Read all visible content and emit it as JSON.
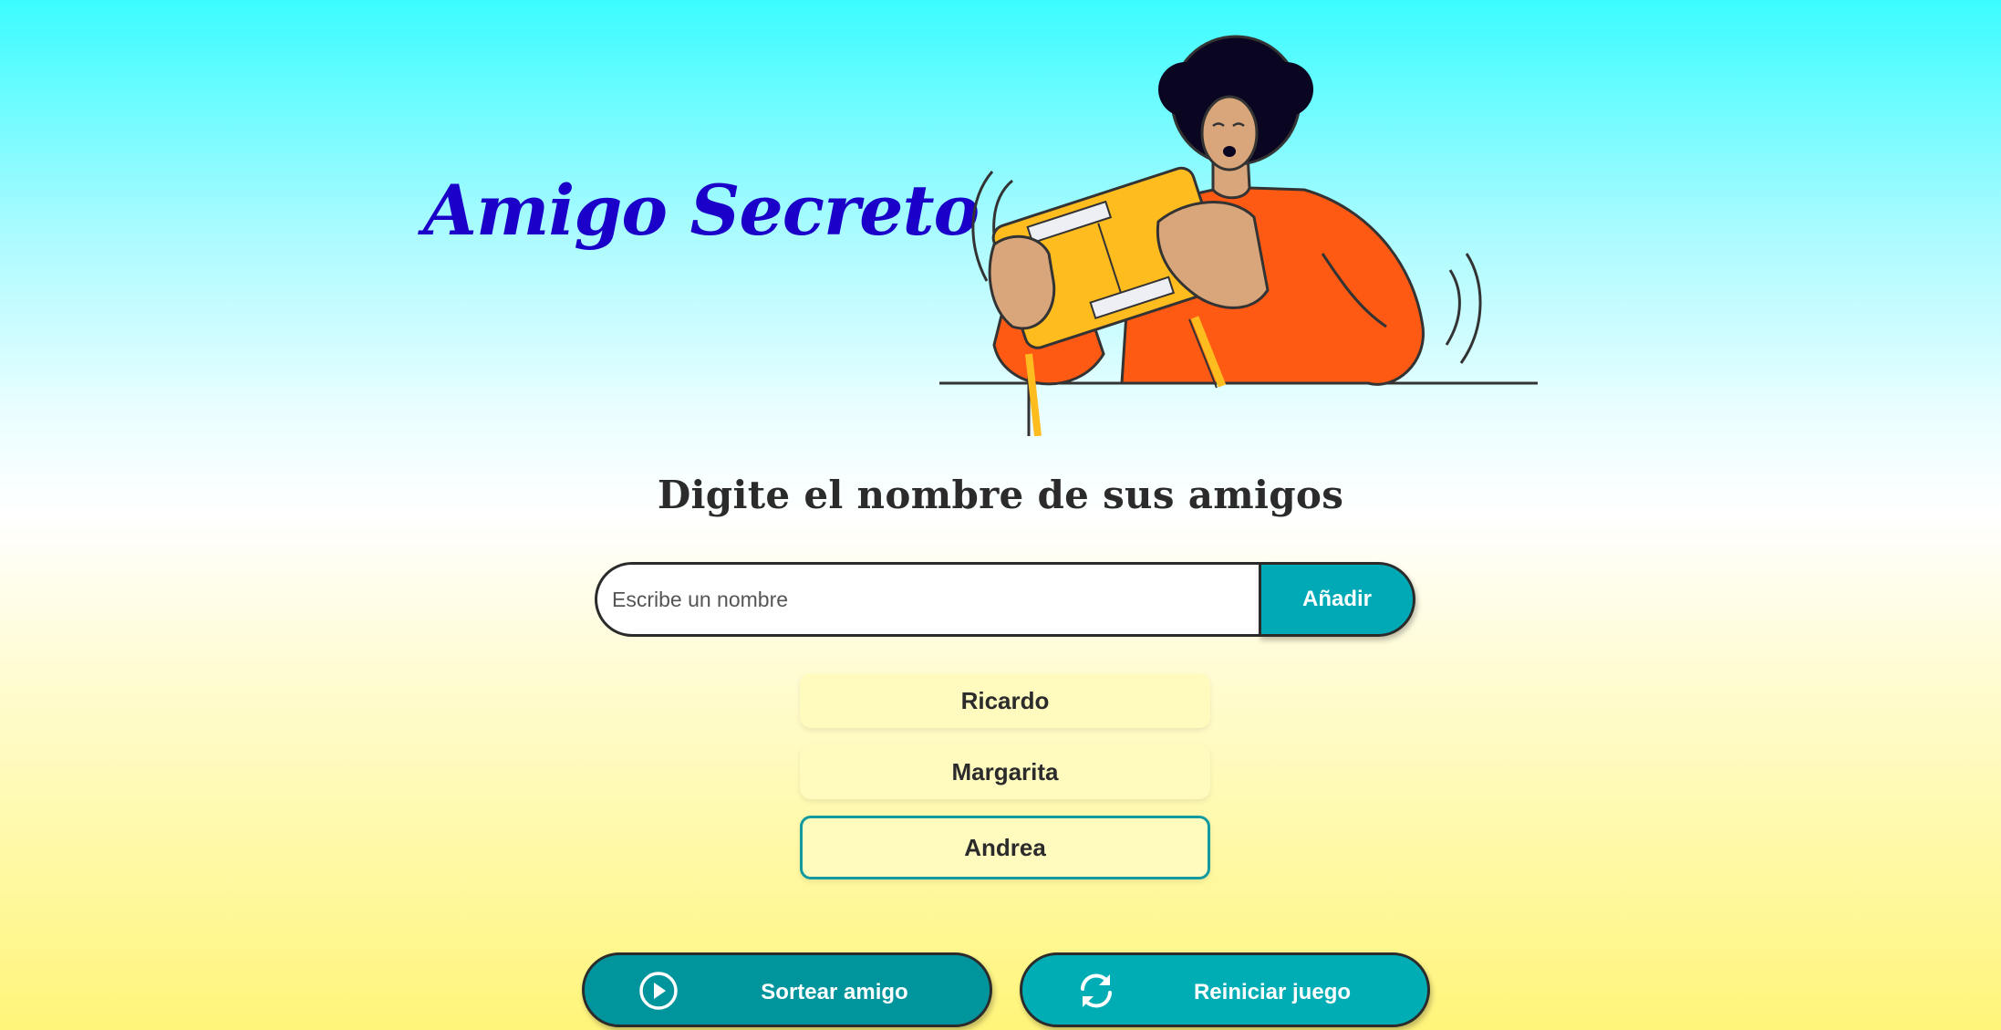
{
  "header": {
    "title": "Amigo Secreto"
  },
  "main": {
    "subtitle": "Digite el nombre de sus amigos",
    "input": {
      "placeholder": "Escribe un nombre",
      "value": ""
    },
    "add_button_label": "Añadir",
    "friends": [
      {
        "name": "Ricardo"
      },
      {
        "name": "Margarita"
      },
      {
        "name": "Andrea"
      }
    ]
  },
  "actions": {
    "draw": {
      "label": "Sortear amigo",
      "icon": "play-circle-icon"
    },
    "reset": {
      "label": "Reiniciar juego",
      "icon": "refresh-icon"
    }
  },
  "colors": {
    "title": "#1a00c8",
    "button_primary": "#00a9b6",
    "button_draw": "#00959c",
    "list_item_bg": "#fffbbf",
    "focus_border": "#129aa0"
  }
}
